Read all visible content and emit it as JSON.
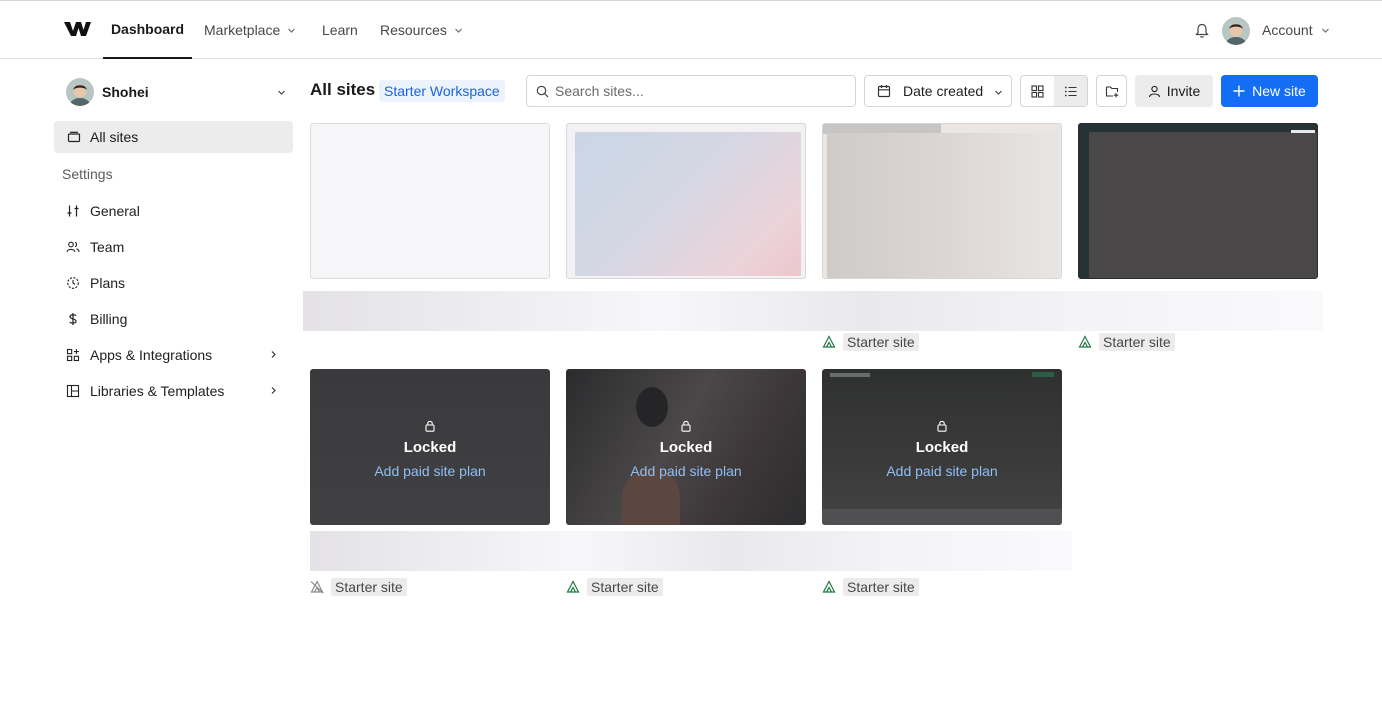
{
  "nav": {
    "items": [
      {
        "label": "Dashboard",
        "active": true,
        "dropdown": false
      },
      {
        "label": "Marketplace",
        "active": false,
        "dropdown": true
      },
      {
        "label": "Learn",
        "active": false,
        "dropdown": false
      },
      {
        "label": "Resources",
        "active": false,
        "dropdown": true
      }
    ],
    "account_label": "Account"
  },
  "sidebar": {
    "workspace_name": "Shohei",
    "all_sites_label": "All sites",
    "settings_heading": "Settings",
    "items": [
      {
        "label": "General",
        "icon": "sliders-icon",
        "submenu": false
      },
      {
        "label": "Team",
        "icon": "team-icon",
        "submenu": false
      },
      {
        "label": "Plans",
        "icon": "plans-icon",
        "submenu": false
      },
      {
        "label": "Billing",
        "icon": "dollar-icon",
        "submenu": false
      },
      {
        "label": "Apps & Integrations",
        "icon": "apps-icon",
        "submenu": true
      },
      {
        "label": "Libraries & Templates",
        "icon": "library-icon",
        "submenu": true
      }
    ]
  },
  "toolbar": {
    "title": "All sites",
    "workspace_badge": "Starter Workspace",
    "search_placeholder": "Search sites...",
    "sort_label": "Date created",
    "invite_label": "Invite",
    "new_site_label": "New site"
  },
  "sites": {
    "locked_title": "Locked",
    "locked_link": "Add paid site plan",
    "starter_tag": "Starter site"
  },
  "colors": {
    "accent": "#146ef5",
    "link_on_dark": "#8fbff7",
    "badge_text": "#1a64d8",
    "badge_bg": "#edf3fd",
    "starter_icon": "#1f7a3e"
  }
}
